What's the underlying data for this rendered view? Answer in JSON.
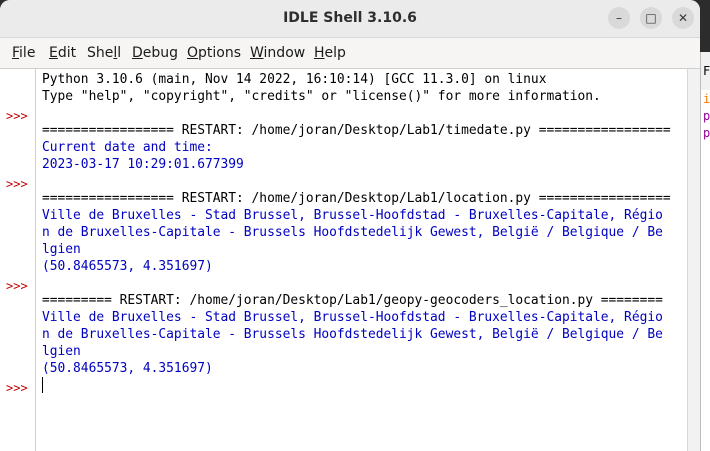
{
  "window": {
    "title": "IDLE Shell 3.10.6"
  },
  "controls": {
    "minimize": "–",
    "maximize": "□",
    "close": "✕"
  },
  "menu": [
    {
      "first": "F",
      "rest": "ile"
    },
    {
      "first": "E",
      "rest": "dit"
    },
    {
      "first": "She",
      "mid": "l",
      "rest": "l"
    },
    {
      "first": "D",
      "rest": "ebug"
    },
    {
      "first": "O",
      "rest": "ptions"
    },
    {
      "first": "W",
      "rest": "indow"
    },
    {
      "first": "H",
      "rest": "elp"
    }
  ],
  "menu_labels": [
    "File",
    "Edit",
    "Shell",
    "Debug",
    "Options",
    "Window",
    "Help"
  ],
  "prompt": ">>>",
  "shell": {
    "lines": [
      {
        "text": "Python 3.10.6 (main, Nov 14 2022, 16:10:14) [GCC 11.3.0] on linux",
        "kind": "plain"
      },
      {
        "text": "Type \"help\", \"copyright\", \"credits\" or \"license()\" for more information.",
        "kind": "plain"
      },
      {
        "text": "",
        "kind": "plain"
      },
      {
        "text": "================= RESTART: /home/joran/Desktop/Lab1/timedate.py =================",
        "kind": "plain"
      },
      {
        "text": "Current date and time:",
        "kind": "stdout"
      },
      {
        "text": "2023-03-17 10:29:01.677399",
        "kind": "stdout"
      },
      {
        "text": "",
        "kind": "plain"
      },
      {
        "text": "================= RESTART: /home/joran/Desktop/Lab1/location.py =================",
        "kind": "plain"
      },
      {
        "text": "Ville de Bruxelles - Stad Brussel, Brussel-Hoofdstad - Bruxelles-Capitale, Régio",
        "kind": "stdout"
      },
      {
        "text": "n de Bruxelles-Capitale - Brussels Hoofdstedelijk Gewest, België / Belgique / Be",
        "kind": "stdout"
      },
      {
        "text": "lgien",
        "kind": "stdout"
      },
      {
        "text": "(50.8465573, 4.351697)",
        "kind": "stdout"
      },
      {
        "text": "",
        "kind": "plain"
      },
      {
        "text": "========= RESTART: /home/joran/Desktop/Lab1/geopy-geocoders_location.py ========",
        "kind": "plain"
      },
      {
        "text": "Ville de Bruxelles - Stad Brussel, Brussel-Hoofdstad - Bruxelles-Capitale, Régio",
        "kind": "stdout"
      },
      {
        "text": "n de Bruxelles-Capitale - Brussels Hoofdstedelijk Gewest, België / Belgique / Be",
        "kind": "stdout"
      },
      {
        "text": "lgien",
        "kind": "stdout"
      },
      {
        "text": "(50.8465573, 4.351697)",
        "kind": "stdout"
      },
      {
        "text": "",
        "kind": "plain"
      },
      {
        "text": "",
        "kind": "plain"
      }
    ]
  },
  "side_window": {
    "chars": [
      {
        "text": "F",
        "color": "#000000"
      },
      {
        "text": "i",
        "color": "#ff7700"
      },
      {
        "text": "p",
        "color": "#900090"
      },
      {
        "text": "p",
        "color": "#900090"
      }
    ]
  },
  "colors": {
    "prompt": "#c00000",
    "stdout": "#0000c0",
    "plain": "#000000"
  }
}
